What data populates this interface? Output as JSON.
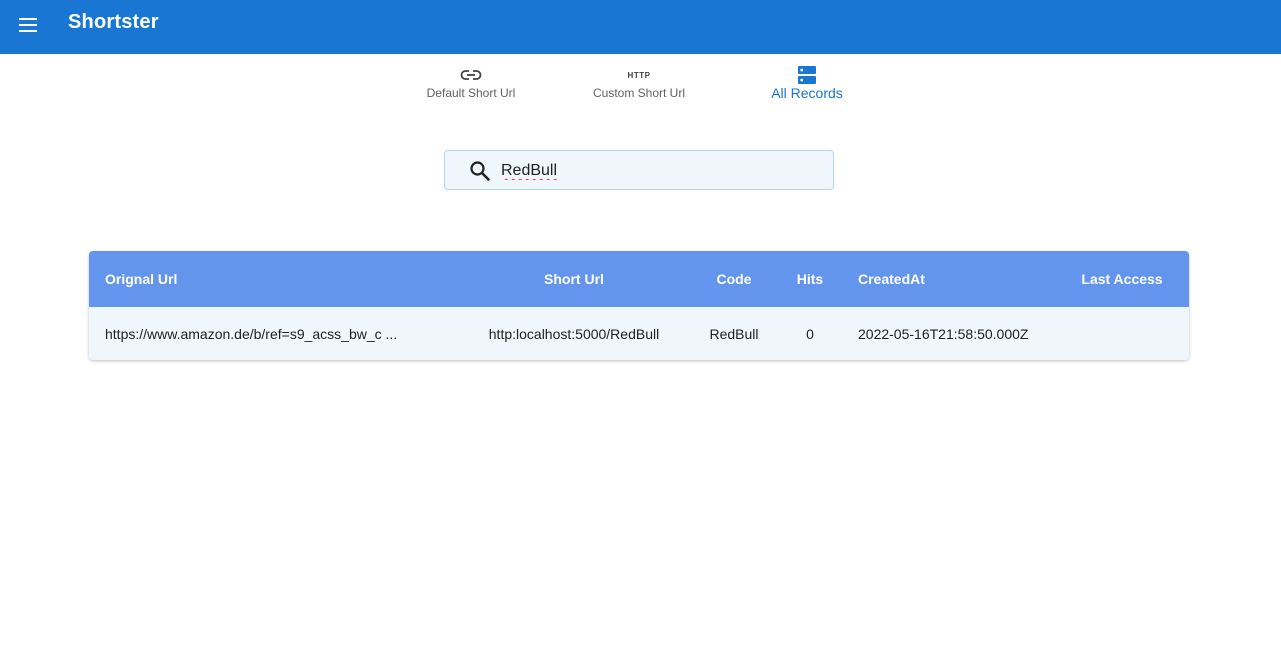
{
  "app": {
    "title": "Shortster",
    "menu_icon": "menu-icon",
    "colors": {
      "appbar": "#1976d2",
      "table_header": "#6495ed",
      "row_bg": "#f0f7fc",
      "active_tab": "#1976d2"
    }
  },
  "tabs": [
    {
      "label": "Default Short Url",
      "icon": "link-icon",
      "active": false
    },
    {
      "label": "Custom Short Url",
      "icon": "http-icon",
      "icon_text": "HTTP",
      "active": false
    },
    {
      "label": "All Records",
      "icon": "storage-icon",
      "active": true
    }
  ],
  "search": {
    "value": "RedBull",
    "icon": "search-icon"
  },
  "table": {
    "columns": [
      "Orignal Url",
      "Short Url",
      "Code",
      "Hits",
      "CreatedAt",
      "Last Access"
    ],
    "rows": [
      {
        "original_url": "https://www.amazon.de/b/ref=s9_acss_bw_c ...",
        "short_url": "http:localhost:5000/RedBull",
        "code": "RedBull",
        "hits": "0",
        "created_at": "2022-05-16T21:58:50.000Z",
        "last_access": ""
      }
    ]
  }
}
